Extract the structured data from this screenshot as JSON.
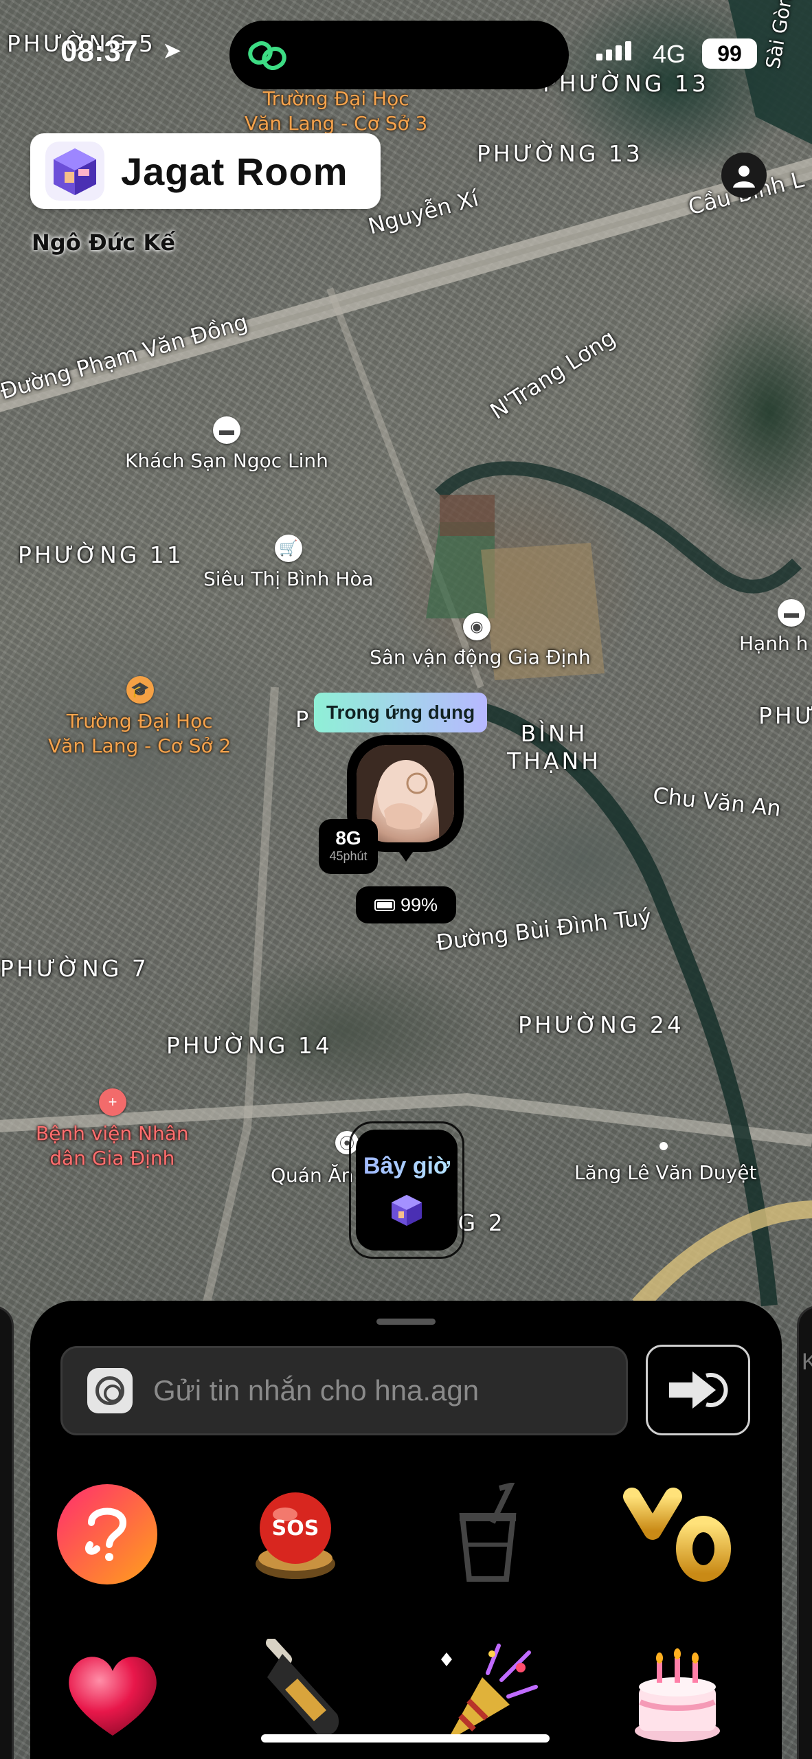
{
  "status_bar": {
    "time": "08:37",
    "network": "4G",
    "battery": "99"
  },
  "header": {
    "app_name": "Jagat Room"
  },
  "map": {
    "wards": [
      "PHƯỜNG 5",
      "PHƯỜNG 13",
      "PHƯỜNG 13",
      "PHƯỜNG 11",
      "PHƯỜNG 7",
      "PHƯỜNG 14",
      "PHƯỜNG 24",
      "PHƯ",
      "NG 2"
    ],
    "district": [
      "BÌNH",
      "THẠNH"
    ],
    "streets": {
      "s1": "Ngô Đức Kế",
      "s2": "Nguyễn Xí",
      "s3": "Cầu Bình L",
      "s4": "Đường Phạm Văn Đồng",
      "s5": "N'Trang Lơng",
      "s6": "Chu Văn An",
      "s7": "Đường Bùi Đình Tuý",
      "s8": "Sài Gòn"
    },
    "pois": {
      "p1": "Khách Sạn Ngọc Linh",
      "p2": "Siêu Thị Bình Hòa",
      "p3": "Sân vận động Gia Định",
      "p4": "Hạnh h",
      "p5": "Quán Ăn",
      "p6": "Lăng Lê Văn Duyệt",
      "p7": "P"
    },
    "schools": {
      "top_line1": "Trường Đại Học",
      "top_line2": "Văn Lang - Cơ Sở 3",
      "left_line1": "Trường Đại Học",
      "left_line2": "Văn Lang - Cơ Sở 2"
    },
    "hospital": {
      "line1": "Bệnh viện Nhân",
      "line2": "dân Gia Định"
    }
  },
  "friend_marker": {
    "status_tag": "Trong ứng dụng",
    "distance": "8G",
    "duration": "45phút",
    "battery": "99%"
  },
  "me_marker": {
    "label": "Bây giờ"
  },
  "sheet": {
    "message_placeholder": "Gửi tin nhắn cho hna.agn",
    "right_peek": "K",
    "reactions_row1": [
      "question-ear",
      "sos",
      "bubble-tea",
      "yo"
    ],
    "reactions_row2": [
      "heart",
      "champagne",
      "party-popper",
      "birthday-cake"
    ]
  },
  "colors": {
    "tag_gradient_start": "#8ff0d6",
    "tag_gradient_end": "#b7b8ff",
    "school_label": "#f6a34d",
    "hospital_label": "#ff6f6f",
    "sheet_bg": "#000000"
  }
}
